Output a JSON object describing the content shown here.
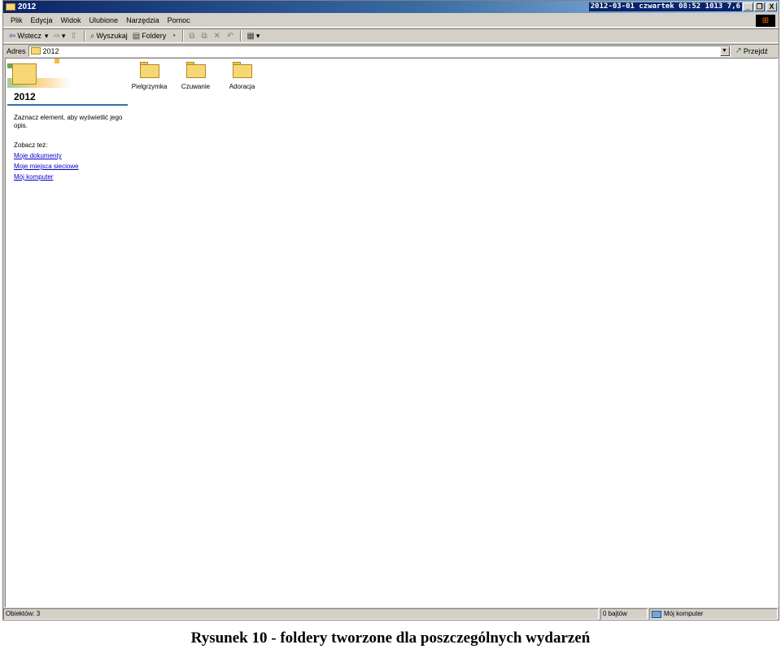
{
  "window": {
    "title": "2012",
    "clock": "2012-03-01 czwartek 08:52  1013  7,6",
    "controls": {
      "minimize": "_",
      "restore": "❐",
      "close": "X"
    }
  },
  "menu": [
    "Plik",
    "Edycja",
    "Widok",
    "Ulubione",
    "Narzędzia",
    "Pomoc"
  ],
  "toolbar": {
    "back_label": "Wstecz",
    "search_label": "Wyszukaj",
    "folders_label": "Foldery"
  },
  "address": {
    "label": "Adres",
    "value": "2012",
    "go_label": "Przejdź"
  },
  "sidebar": {
    "title": "2012",
    "description": "Zaznacz element, aby wyświetlić jego opis.",
    "see_also": "Zobacz też:",
    "links": [
      "Moje dokumenty",
      "Moje miejsca sieciowe",
      "Mój komputer"
    ]
  },
  "folders": [
    {
      "label": "Pielgrzymka",
      "icon": "folder-icon"
    },
    {
      "label": "Czuwanie",
      "icon": "folder-icon"
    },
    {
      "label": "Adoracja",
      "icon": "folder-icon"
    }
  ],
  "status": {
    "objects": "Obiektów: 3",
    "size": "0 bajtów",
    "location": "Mój komputer"
  },
  "caption": "Rysunek 10 - foldery tworzone dla poszczególnych wydarzeń",
  "colors": {
    "title_start": "#0a246a",
    "title_end": "#a6caf0",
    "chrome": "#d4d0c8",
    "folder": "#f7d774",
    "link": "#0000cc"
  }
}
